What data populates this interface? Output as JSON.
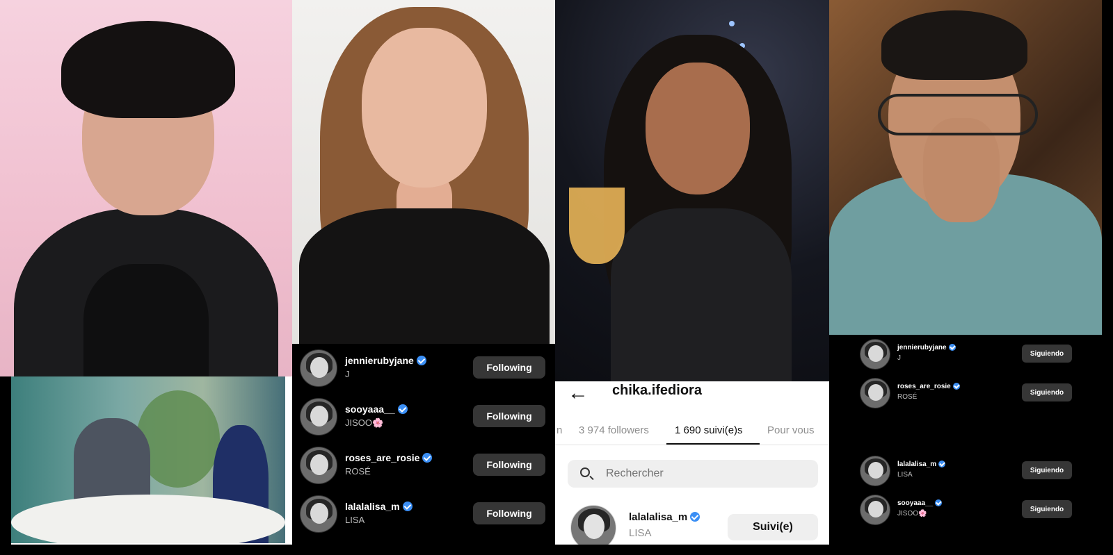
{
  "english_list": {
    "rows": [
      {
        "username": "jennierubyjane",
        "subtitle": "J",
        "button": "Following"
      },
      {
        "username": "sooyaaa__",
        "subtitle": "JISOO🌸",
        "button": "Following"
      },
      {
        "username": "roses_are_rosie",
        "subtitle": "ROSÉ",
        "button": "Following"
      },
      {
        "username": "lalalalisa_m",
        "subtitle": "LISA",
        "button": "Following"
      }
    ]
  },
  "french_profile": {
    "back_icon": "arrow-left-icon",
    "username": "chika.ifediora",
    "tabs": [
      {
        "label": "n"
      },
      {
        "label": "3 974 followers"
      },
      {
        "label": "1 690 suivi(e)s"
      },
      {
        "label": "Pour vous"
      }
    ],
    "search_placeholder": "Rechercher",
    "row": {
      "username": "lalalalisa_m",
      "subtitle": "LISA",
      "button": "Suivi(e)"
    }
  },
  "spanish_list": {
    "rows": [
      {
        "username": "jennierubyjane",
        "subtitle": "J",
        "button": "Siguiendo"
      },
      {
        "username": "roses_are_rosie",
        "subtitle": "ROSÉ",
        "button": "Siguiendo"
      },
      {
        "username": "lalalalisa_m",
        "subtitle": "LISA",
        "button": "Siguiendo"
      },
      {
        "username": "sooyaaa__",
        "subtitle": "JISOO🌸",
        "button": "Siguiendo"
      }
    ]
  },
  "colors": {
    "verified_badge": "#3b8ff5",
    "dark_button": "#363636",
    "light_button": "#efefef"
  }
}
